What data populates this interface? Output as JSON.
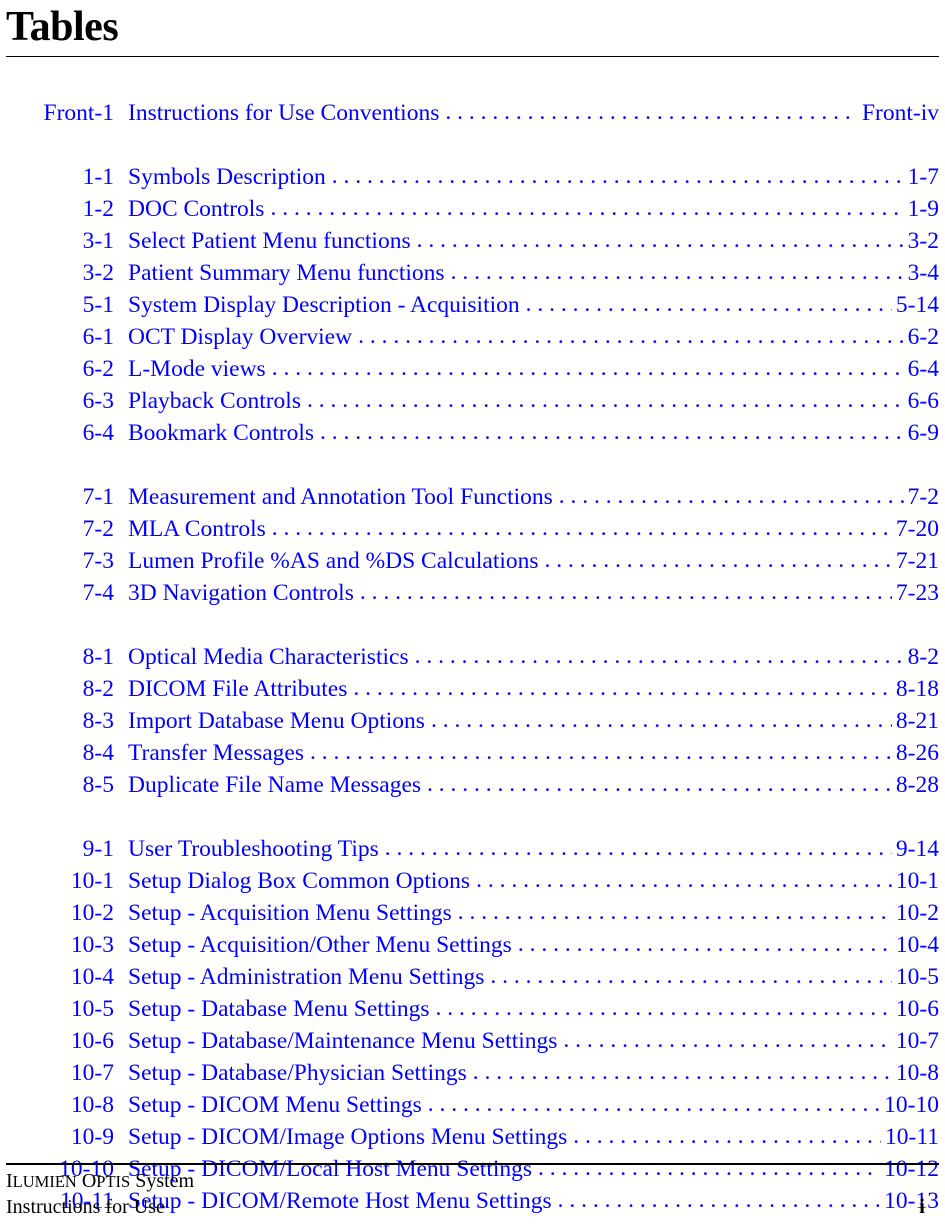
{
  "page": {
    "title": "Tables"
  },
  "toc": {
    "front": [
      {
        "num": "Front-1",
        "label": "Instructions for Use Conventions",
        "page": "Front-iv"
      }
    ],
    "groups": [
      [
        {
          "num": "1-1",
          "label": "Symbols Description",
          "page": "1-7"
        },
        {
          "num": "1-2",
          "label": "DOC Controls",
          "page": "1-9"
        },
        {
          "num": "3-1",
          "label": "Select Patient Menu functions",
          "page": "3-2"
        },
        {
          "num": "3-2",
          "label": "Patient Summary Menu functions",
          "page": "3-4"
        },
        {
          "num": "5-1",
          "label": "System Display Description - Acquisition",
          "page": "5-14"
        },
        {
          "num": "6-1",
          "label": "OCT Display Overview",
          "page": "6-2"
        },
        {
          "num": "6-2",
          "label": "L-Mode views",
          "page": "6-4"
        },
        {
          "num": "6-3",
          "label": "Playback Controls",
          "page": "6-6"
        },
        {
          "num": "6-4",
          "label": "Bookmark Controls",
          "page": "6-9"
        }
      ],
      [
        {
          "num": "7-1",
          "label": "Measurement and Annotation Tool Functions",
          "page": "7-2"
        },
        {
          "num": "7-2",
          "label": "MLA Controls",
          "page": "7-20"
        },
        {
          "num": "7-3",
          "label": "Lumen Profile %AS and %DS Calculations",
          "page": "7-21"
        },
        {
          "num": "7-4",
          "label": "3D Navigation Controls",
          "page": "7-23"
        }
      ],
      [
        {
          "num": "8-1",
          "label": "Optical Media Characteristics",
          "page": "8-2"
        },
        {
          "num": "8-2",
          "label": "DICOM File Attributes",
          "page": "8-18"
        },
        {
          "num": "8-3",
          "label": "Import Database Menu Options",
          "page": "8-21"
        },
        {
          "num": "8-4",
          "label": "Transfer Messages",
          "page": "8-26"
        },
        {
          "num": "8-5",
          "label": "Duplicate File Name Messages",
          "page": "8-28"
        }
      ],
      [
        {
          "num": "9-1",
          "label": "User Troubleshooting Tips",
          "page": "9-14"
        },
        {
          "num": "10-1",
          "label": "Setup Dialog Box Common Options",
          "page": "10-1"
        },
        {
          "num": "10-2",
          "label": "Setup - Acquisition Menu Settings",
          "page": "10-2"
        },
        {
          "num": "10-3",
          "label": "Setup - Acquisition/Other Menu Settings",
          "page": "10-4"
        },
        {
          "num": "10-4",
          "label": "Setup - Administration Menu Settings",
          "page": "10-5"
        },
        {
          "num": "10-5",
          "label": "Setup - Database Menu Settings",
          "page": "10-6"
        },
        {
          "num": "10-6",
          "label": "Setup - Database/Maintenance Menu Settings",
          "page": "10-7"
        },
        {
          "num": "10-7",
          "label": "Setup - Database/Physician Settings",
          "page": "10-8"
        },
        {
          "num": "10-8",
          "label": "Setup - DICOM Menu Settings",
          "page": "10-10"
        },
        {
          "num": "10-9",
          "label": "Setup - DICOM/Image Options Menu Settings",
          "page": "10-11"
        },
        {
          "num": "10-10",
          "label": "Setup - DICOM/Local Host Menu Settings",
          "page": "10-12"
        },
        {
          "num": "10-11",
          "label": "Setup - DICOM/Remote Host Menu Settings",
          "page": "10-13"
        }
      ]
    ]
  },
  "footer": {
    "line1_a": "I",
    "line1_b": "LUMIEN",
    "line1_c": " O",
    "line1_d": "PTIS",
    "line1_e": " System",
    "line2": "Instructions for Use",
    "page_number": "i"
  },
  "colors": {
    "link": "#0000ff",
    "text": "#000000",
    "background": "#ffffff"
  }
}
